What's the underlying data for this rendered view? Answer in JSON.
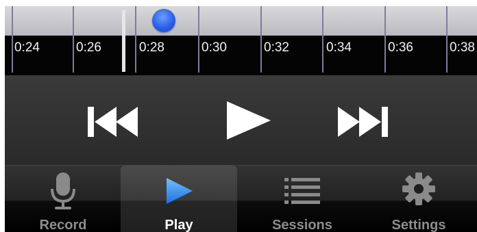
{
  "timeline": {
    "ticks": [
      "0:24",
      "0:26",
      "0:28",
      "0:30",
      "0:32",
      "0:34",
      "0:36",
      "0:38"
    ]
  },
  "transport": {
    "icons": [
      "skip-back-icon",
      "play-icon",
      "skip-forward-icon"
    ]
  },
  "tabs": [
    {
      "label": "Record",
      "icon": "microphone-icon"
    },
    {
      "label": "Play",
      "icon": "play-icon",
      "active": true
    },
    {
      "label": "Sessions",
      "icon": "list-icon"
    },
    {
      "label": "Settings",
      "icon": "gear-icon"
    }
  ],
  "colors": {
    "marker": "#2a5fe8",
    "active_tab_icon": "#2f8cf0",
    "inactive_icon": "#8a8a8a"
  }
}
